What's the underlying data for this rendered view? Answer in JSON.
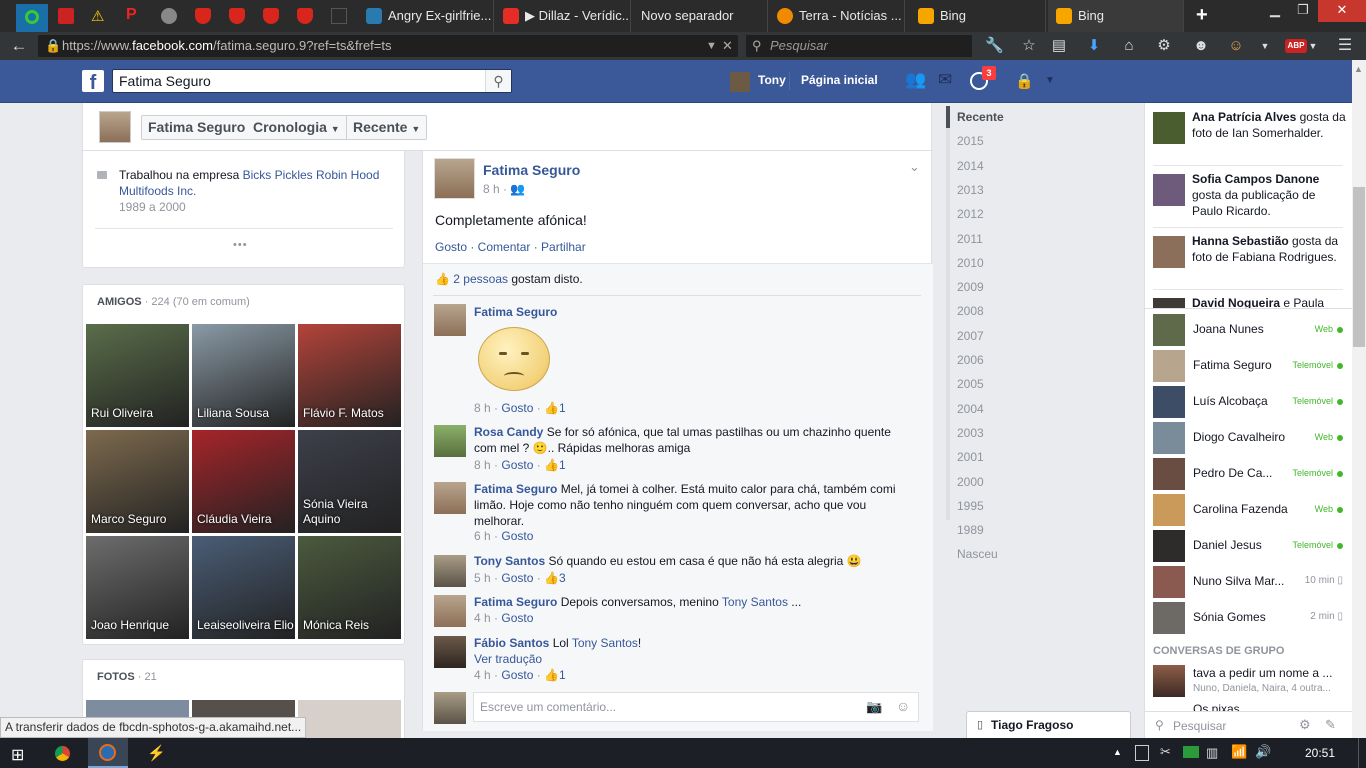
{
  "browser": {
    "tabs": [
      {
        "label": "Angry Ex-girlfrie...",
        "icon": "clipboard-icon",
        "color": "#2a7ab0"
      },
      {
        "label": "▶ Dillaz - Verídic...",
        "icon": "youtube-icon",
        "color": "#e52d27"
      },
      {
        "label": "Novo separador",
        "icon": "",
        "color": ""
      },
      {
        "label": "Terra - Notícias ...",
        "icon": "terra-icon",
        "color": "#f08a00"
      },
      {
        "label": "Bing",
        "icon": "bing-icon",
        "color": "#f7a600"
      },
      {
        "label": "Bing",
        "icon": "bing-icon",
        "color": "#f7a600"
      }
    ],
    "new_tab": "+",
    "url_prefix": "https://www.",
    "url_domain": "facebook.com",
    "url_path": "/fatima.seguro.9?ref=ts&fref=ts",
    "search_placeholder": "Pesquisar",
    "abp_label": "ABP"
  },
  "fb": {
    "logo": "f",
    "search_value": "Fatima Seguro",
    "user_name": "Tony",
    "home_label": "Página inicial",
    "notif_count": "3",
    "profile_name": "Fatima Seguro",
    "btn_timeline": "Cronologia",
    "btn_recent": "Recente"
  },
  "about": {
    "work_prefix": "Trabalhou na empresa ",
    "work_company": "Bicks Pickles Robin Hood Multifoods Inc.",
    "work_years": "1989 a 2000",
    "more": "•••"
  },
  "friends": {
    "title": "AMIGOS",
    "count": "· 224 (70 em comum)",
    "items": [
      {
        "name": "Rui Oliveira",
        "color": "#5a6e4a"
      },
      {
        "name": "Liliana Sousa",
        "color": "#8a9aa6"
      },
      {
        "name": "Flávio F. Matos",
        "color": "#b3443a"
      },
      {
        "name": "Marco Seguro",
        "color": "#7d6a4e"
      },
      {
        "name": "Cláudia Vieira",
        "color": "#a6242a"
      },
      {
        "name": "Sónia Vieira Aquino",
        "color": "#3d3f4a"
      },
      {
        "name": "Joao Henrique",
        "color": "#6d6d6d"
      },
      {
        "name": "Leaiseoliveira Elio",
        "color": "#4a5d76"
      },
      {
        "name": "Mónica Reis",
        "color": "#4b5a3e"
      }
    ]
  },
  "photos": {
    "title": "FOTOS",
    "count": "· 21"
  },
  "post": {
    "author": "Fatima Seguro",
    "time": "8 h ·",
    "text": "Completamente afónica!",
    "actions": "Gosto · Comentar · Partilhar",
    "likes_link": "2 pessoas",
    "likes_suffix": " gostam disto."
  },
  "comments": [
    {
      "name": "Fatima Seguro",
      "text": "",
      "meta": "8 h · ",
      "like": "Gosto",
      "count": "1"
    },
    {
      "name": "Rosa Candy",
      "text": "Se for só afónica, que tal umas pastilhas ou um chazinho quente com mel ? 🙂.. Rápidas melhoras amiga",
      "meta": "8 h · ",
      "like": "Gosto",
      "count": "1"
    },
    {
      "name": "Fatima Seguro",
      "text": "Mel, já tomei à colher. Está muito calor para chá, também comi limão. Hoje como não tenho ninguém com quem conversar, acho que vou melhorar.",
      "meta": "6 h · ",
      "like": "Gosto",
      "count": ""
    },
    {
      "name": "Tony Santos",
      "text": "Só quando eu estou em casa é que não há esta alegria 😃",
      "meta": "5 h · ",
      "like": "Gosto",
      "count": "3"
    },
    {
      "name": "Fatima Seguro",
      "text": "Depois conversamos, menino ",
      "tag": "Tony Santos",
      "text_end": " ...",
      "meta": "4 h · ",
      "like": "Gosto",
      "count": ""
    },
    {
      "name": "Fábio Santos",
      "text": "Lol ",
      "tag": "Tony Santos",
      "text_end": "!",
      "translate": "Ver tradução",
      "meta": "4 h · ",
      "like": "Gosto",
      "count": "1"
    }
  ],
  "comment_placeholder": "Escreve um comentário...",
  "years": [
    "Recente",
    "2015",
    "2014",
    "2013",
    "2012",
    "2011",
    "2010",
    "2009",
    "2008",
    "2007",
    "2006",
    "2005",
    "2004",
    "2003",
    "2001",
    "2000",
    "1995",
    "1989",
    "Nasceu"
  ],
  "ticker": [
    {
      "bold": "Ana Patrícia Alves",
      "rest": " gosta da foto de Ian Somerhalder."
    },
    {
      "bold": "Sofia Campos Danone",
      "rest": " gosta da publicação de Paulo Ricardo."
    },
    {
      "bold": "Hanna Sebastião",
      "rest": " gosta da foto de Fabiana Rodrigues."
    },
    {
      "bold": "David Nogueira",
      "rest": " e Paula Garcia são agora amigos."
    }
  ],
  "chat": [
    {
      "name": "Joana Nunes",
      "status": "Web",
      "time": ""
    },
    {
      "name": "Fatima Seguro",
      "status": "Telemóvel",
      "time": ""
    },
    {
      "name": "Luís Alcobaça",
      "status": "Telemóvel",
      "time": ""
    },
    {
      "name": "Diogo Cavalheiro",
      "status": "Web",
      "time": ""
    },
    {
      "name": "Pedro De Ca...",
      "status": "Telemóvel",
      "time": ""
    },
    {
      "name": "Carolina Fazenda",
      "status": "Web",
      "time": ""
    },
    {
      "name": "Daniel Jesus",
      "status": "Telemóvel",
      "time": ""
    },
    {
      "name": "Nuno Silva Mar...",
      "status": "",
      "time": "10 min"
    },
    {
      "name": "Sónia Gomes",
      "status": "",
      "time": "2 min"
    }
  ],
  "group": {
    "title": "CONVERSAS DE GRUPO",
    "line1": "tava a pedir um nome a ...",
    "line2": "Nuno, Daniela, Naira, 4 outra...",
    "line3": "Os pixas"
  },
  "chat_search": "Pesquisar",
  "chat_tab": "Tiago Fragoso",
  "status_bar": "A transferir dados de fbcdn-sphotos-g-a.akamaihd.net...",
  "clock": "20:51"
}
